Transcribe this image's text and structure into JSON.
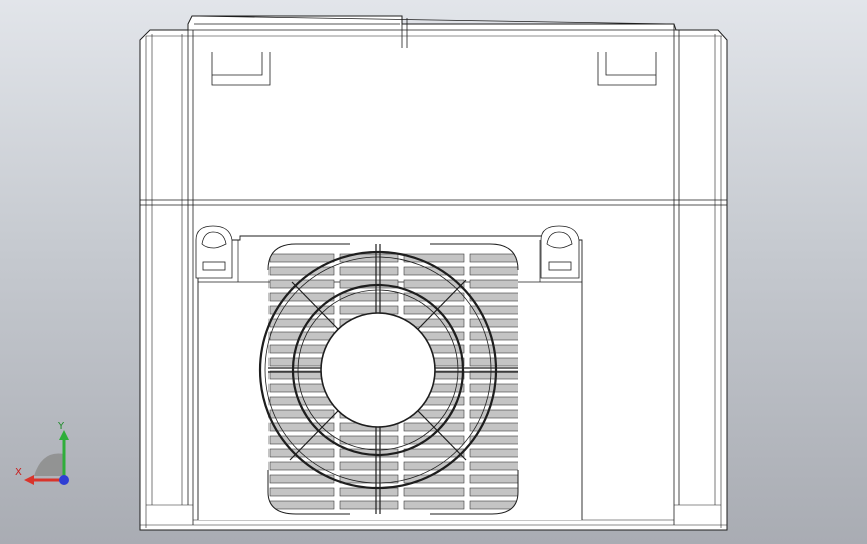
{
  "viewport": {
    "background_top": "#e2e5ea",
    "background_bottom": "#a9acb3",
    "model_fill": "#ffffff",
    "model_line": "#1e1e1e",
    "vent_slot_fill": "#c4c4c4"
  },
  "triad": {
    "x_label": "X",
    "y_label": "Y",
    "x_color": "#d9342b",
    "y_color": "#2fae3a",
    "z_color": "#2f3fd4",
    "x_label_color": "#c81e1e",
    "y_label_color": "#1e8c2a"
  }
}
